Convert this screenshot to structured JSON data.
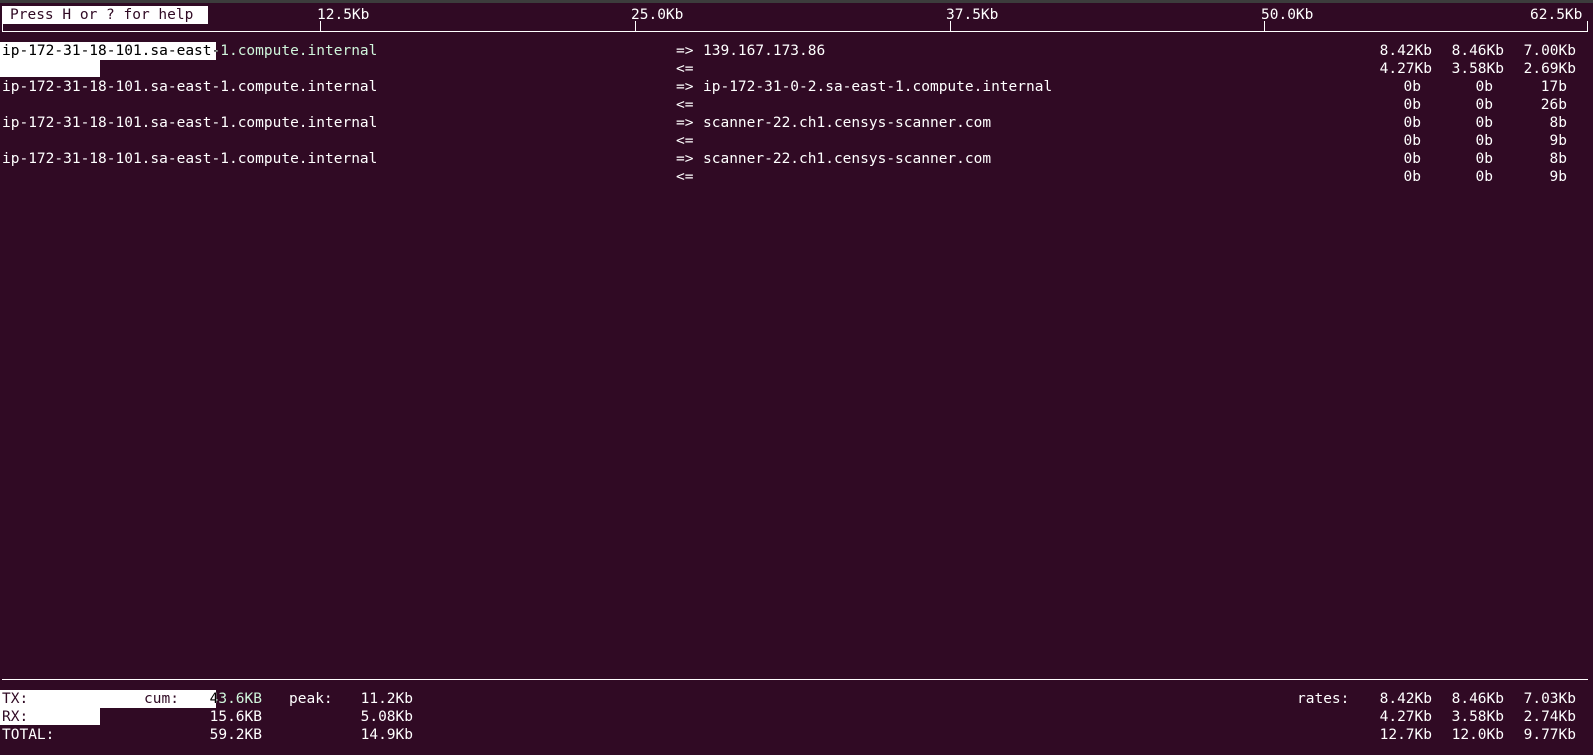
{
  "help_text": "Press H or ? for help",
  "scale": [
    "12.5Kb",
    "25.0Kb",
    "37.5Kb",
    "50.0Kb",
    "62.5Kb"
  ],
  "connections": [
    {
      "src": "ip-172-31-18-101.sa-east-1.compute.internal",
      "dst": "139.167.173.86",
      "tx_arrow": "=>",
      "rx_arrow": "<=",
      "tx": [
        "8.42Kb",
        "8.46Kb",
        "7.00Kb"
      ],
      "rx": [
        "4.27Kb",
        "3.58Kb",
        "2.69Kb"
      ]
    },
    {
      "src": "ip-172-31-18-101.sa-east-1.compute.internal",
      "dst": "ip-172-31-0-2.sa-east-1.compute.internal",
      "tx_arrow": "=>",
      "rx_arrow": "<=",
      "tx": [
        "0b",
        "0b",
        "17b"
      ],
      "rx": [
        "0b",
        "0b",
        "26b"
      ]
    },
    {
      "src": "ip-172-31-18-101.sa-east-1.compute.internal",
      "dst": "scanner-22.ch1.censys-scanner.com",
      "tx_arrow": "=>",
      "rx_arrow": "<=",
      "tx": [
        "0b",
        "0b",
        "8b"
      ],
      "rx": [
        "0b",
        "0b",
        "9b"
      ]
    },
    {
      "src": "ip-172-31-18-101.sa-east-1.compute.internal",
      "dst": "scanner-22.ch1.censys-scanner.com",
      "tx_arrow": "=>",
      "rx_arrow": "<=",
      "tx": [
        "0b",
        "0b",
        "8b"
      ],
      "rx": [
        "0b",
        "0b",
        "9b"
      ]
    }
  ],
  "totals": {
    "tx_label": "TX:",
    "rx_label": "RX:",
    "total_label": "TOTAL:",
    "cum_label": "cum:",
    "peak_label": "peak:",
    "rates_label": "rates:",
    "tx_cum": "43.6KB",
    "rx_cum": "15.6KB",
    "total_cum": "59.2KB",
    "tx_peak": "11.2Kb",
    "rx_peak": "5.08Kb",
    "total_peak": "14.9Kb",
    "tx_rates": [
      "8.42Kb",
      "8.46Kb",
      "7.03Kb"
    ],
    "rx_rates": [
      "4.27Kb",
      "3.58Kb",
      "2.74Kb"
    ],
    "total_rates": [
      "12.7Kb",
      "12.0Kb",
      "9.77Kb"
    ]
  },
  "colors": {
    "background": "#300a24",
    "foreground": "#ffffff"
  }
}
